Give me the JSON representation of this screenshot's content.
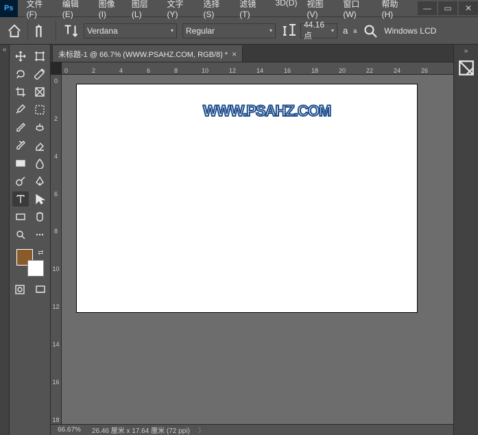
{
  "app": {
    "logo_text": "Ps"
  },
  "menu": {
    "file": "文件(F)",
    "edit": "编辑(E)",
    "image": "图像(I)",
    "layer": "图层(L)",
    "type": "文字(Y)",
    "select": "选择(S)",
    "filter": "滤镜(T)",
    "threeD": "3D(D)",
    "view": "视图(V)",
    "window": "窗口(W)",
    "help": "帮助(H)"
  },
  "options": {
    "font": "Verdana",
    "font_style": "Regular",
    "font_size": "44.16 点",
    "anti_alias_label": "a",
    "anti_alias_label2": "a",
    "anti_alias_mode": "Windows LCD"
  },
  "doc": {
    "tab_label": "未标题-1 @ 66.7% (WWW.PSAHZ.COM, RGB/8) *",
    "canvas_text": "WWW.PSAHZ.COM"
  },
  "ruler": {
    "h": [
      "0",
      "2",
      "4",
      "6",
      "8",
      "10",
      "12",
      "14",
      "16",
      "18",
      "20",
      "22",
      "24",
      "26"
    ],
    "v": [
      "0",
      "",
      "2",
      "",
      "4",
      "",
      "6",
      "",
      "8",
      "",
      "10",
      "",
      "12",
      "",
      "14",
      "",
      "16",
      "",
      "18"
    ]
  },
  "status": {
    "zoom": "66.67%",
    "doc_size": "26.46 厘米 x 17.64 厘米 (72 ppi)",
    "caret": "〉"
  },
  "colors": {
    "fg": "#8b5a2b",
    "bg": "#ffffff"
  },
  "icons": {
    "minimize": "—",
    "maximize": "▭",
    "close": "✕",
    "expand_left": "«",
    "expand_right": "»",
    "home": "⌂",
    "tab_close": "×"
  }
}
